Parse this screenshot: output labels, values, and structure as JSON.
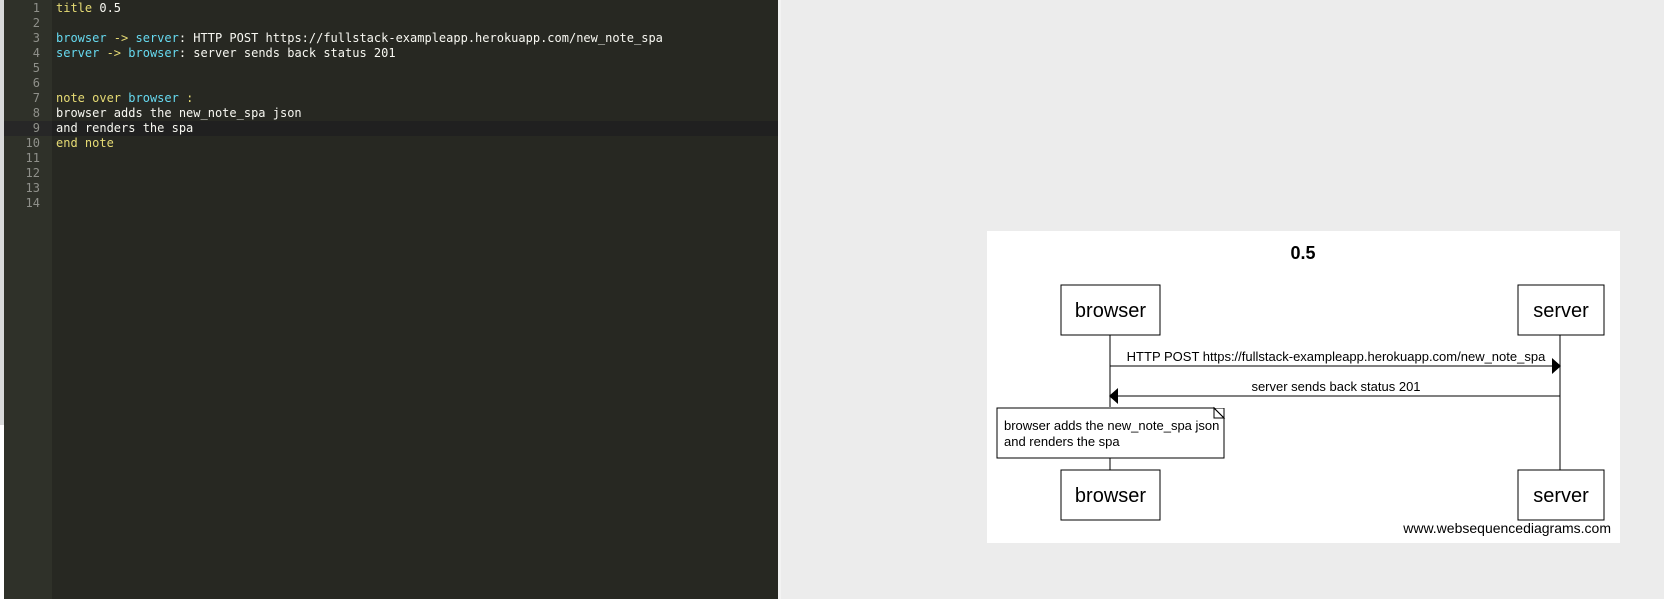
{
  "editor": {
    "lines": [
      {
        "num": "1",
        "segs": [
          [
            "title",
            "k"
          ],
          [
            " 0.5",
            ""
          ]
        ]
      },
      {
        "num": "2",
        "segs": []
      },
      {
        "num": "3",
        "segs": [
          [
            "browser",
            "ent"
          ],
          [
            " -> ",
            "k"
          ],
          [
            "server",
            "ent"
          ],
          [
            ": HTTP POST https://fullstack-exampleapp.herokuapp.com/new_note_spa",
            ""
          ]
        ]
      },
      {
        "num": "4",
        "segs": [
          [
            "server",
            "ent"
          ],
          [
            " -> ",
            "k"
          ],
          [
            "browser",
            "ent"
          ],
          [
            ": server sends back status 201",
            ""
          ]
        ]
      },
      {
        "num": "5",
        "segs": []
      },
      {
        "num": "6",
        "segs": []
      },
      {
        "num": "7",
        "segs": [
          [
            "note over",
            "k"
          ],
          [
            " ",
            ""
          ],
          [
            "browser",
            "ent"
          ],
          [
            " :",
            "k"
          ]
        ]
      },
      {
        "num": "8",
        "segs": [
          [
            "browser adds the new_note_spa json",
            ""
          ]
        ]
      },
      {
        "num": "9",
        "segs": [
          [
            "and renders the spa",
            ""
          ]
        ],
        "active": true
      },
      {
        "num": "10",
        "segs": [
          [
            "end note",
            "k"
          ]
        ]
      },
      {
        "num": "11",
        "segs": []
      },
      {
        "num": "12",
        "segs": []
      },
      {
        "num": "13",
        "segs": []
      },
      {
        "num": "14",
        "segs": []
      }
    ],
    "colors": {
      "background": "#272822",
      "gutter": "#2f3129",
      "keyword": "#e6db74",
      "entity": "#66d9ef",
      "text": "#f8f8f2",
      "line_number": "#8f908a"
    }
  },
  "diagram": {
    "title": "0.5",
    "participants": {
      "left": "browser",
      "right": "server"
    },
    "messages": {
      "request": "HTTP POST https://fullstack-exampleapp.herokuapp.com/new_note_spa",
      "response": "server sends back status 201"
    },
    "note": {
      "line1": "browser adds the new_note_spa json",
      "line2": "and renders the spa"
    },
    "watermark": "www.websequencediagrams.com"
  }
}
